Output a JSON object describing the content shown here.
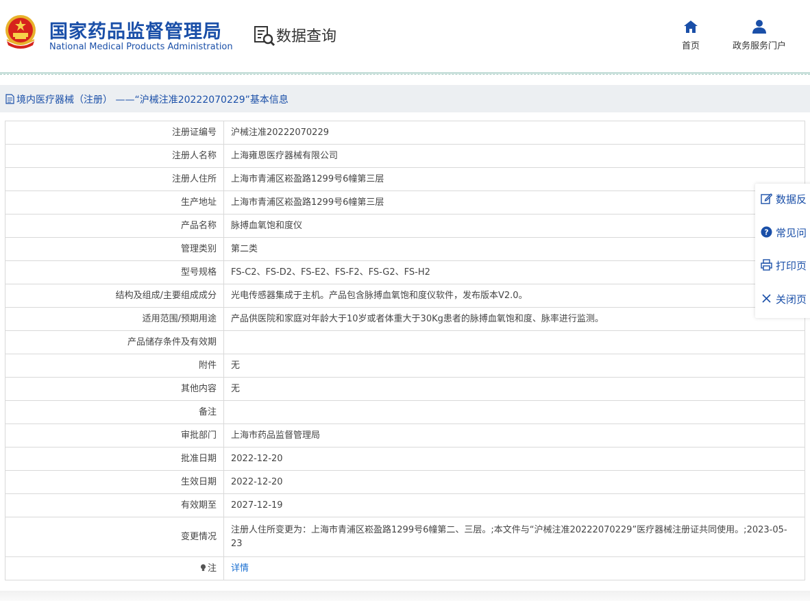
{
  "header": {
    "org_cn": "国家药品监督管理局",
    "org_en": "National Medical Products Administration",
    "query_title": "数据查询",
    "nav": {
      "home": "首页",
      "portal": "政务服务门户"
    }
  },
  "page_bar": {
    "title": "境内医疗器械（注册） ——“沪械注准20222070229”基本信息"
  },
  "rows": [
    {
      "label": "注册证编号",
      "value": "沪械注准20222070229"
    },
    {
      "label": "注册人名称",
      "value": "上海雍恩医疗器械有限公司"
    },
    {
      "label": "注册人住所",
      "value": "上海市青浦区崧盈路1299号6幢第三层"
    },
    {
      "label": "生产地址",
      "value": "上海市青浦区崧盈路1299号6幢第三层"
    },
    {
      "label": "产品名称",
      "value": "脉搏血氧饱和度仪"
    },
    {
      "label": "管理类别",
      "value": "第二类"
    },
    {
      "label": "型号规格",
      "value": "FS-C2、FS-D2、FS-E2、FS-F2、FS-G2、FS-H2"
    },
    {
      "label": "结构及组成/主要组成成分",
      "value": "光电传感器集成于主机。产品包含脉搏血氧饱和度仪软件，发布版本V2.0。"
    },
    {
      "label": "适用范围/预期用途",
      "value": "产品供医院和家庭对年龄大于10岁或者体重大于30Kg患者的脉搏血氧饱和度、脉率进行监测。"
    },
    {
      "label": "产品储存条件及有效期",
      "value": ""
    },
    {
      "label": "附件",
      "value": "无"
    },
    {
      "label": "其他内容",
      "value": "无"
    },
    {
      "label": "备注",
      "value": ""
    },
    {
      "label": "审批部门",
      "value": "上海市药品监督管理局"
    },
    {
      "label": "批准日期",
      "value": "2022-12-20"
    },
    {
      "label": "生效日期",
      "value": "2022-12-20"
    },
    {
      "label": "有效期至",
      "value": "2027-12-19"
    },
    {
      "label": "变更情况",
      "value": "注册人住所变更为：上海市青浦区崧盈路1299号6幢第二、三层。;本文件与“沪械注准20222070229”医疗器械注册证共同使用。;2023-05-23"
    }
  ],
  "note_row": {
    "label": "注",
    "link": "详情"
  },
  "float_panel": {
    "feedback": "数据反",
    "faq": "常见问",
    "print": "打印页",
    "close": "关闭页"
  },
  "colors": {
    "brand_blue": "#1a4fa8",
    "link_blue": "#1a6fd1",
    "bar_bg": "#eceff2"
  }
}
